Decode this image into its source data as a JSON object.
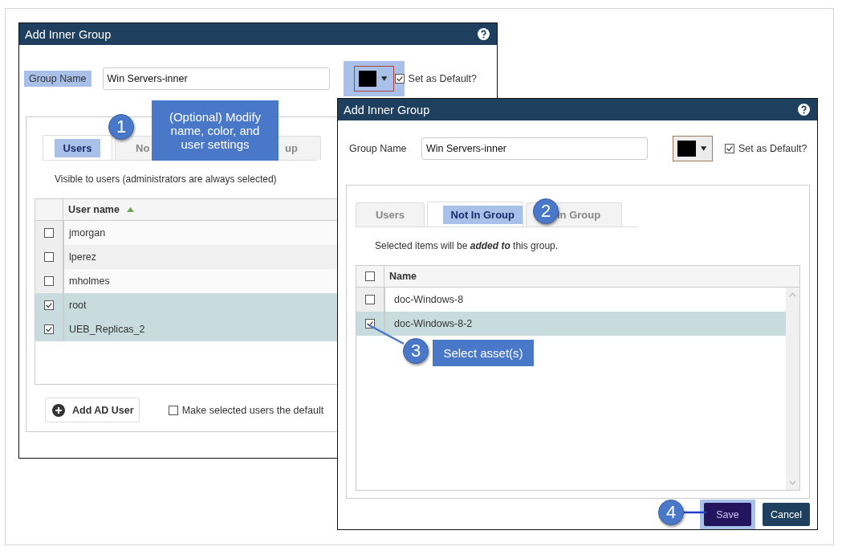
{
  "back_dialog": {
    "title": "Add Inner Group",
    "group_name_label": "Group Name",
    "group_name_value": "Win Servers-inner",
    "set_default": {
      "label": "Set as Default?",
      "checked": true
    },
    "tabs": [
      {
        "label": "Users",
        "selected": true
      },
      {
        "label": "No",
        "selected": false
      },
      {
        "label": "up",
        "selected": false
      }
    ],
    "hint": "Visible to users (administrators are always selected)",
    "table": {
      "columns": [
        "User name"
      ],
      "rows": [
        {
          "name": "jmorgan",
          "checked": false
        },
        {
          "name": "lperez",
          "checked": false
        },
        {
          "name": "mholmes",
          "checked": false
        },
        {
          "name": "root",
          "checked": true
        },
        {
          "name": "UEB_Replicas_2",
          "checked": true
        }
      ]
    },
    "add_button": "Add AD User",
    "default_option": {
      "label": "Make selected users the default",
      "checked": false
    }
  },
  "front_dialog": {
    "title": "Add Inner Group",
    "group_name_label": "Group Name",
    "group_name_value": "Win Servers-inner",
    "set_default": {
      "label": "Set as Default?",
      "checked": true
    },
    "tabs": [
      {
        "label": "Users",
        "selected": false
      },
      {
        "label": "Not In Group",
        "selected": true
      },
      {
        "label": "In Group",
        "selected": false
      }
    ],
    "hint": "Selected items will be **added to** this group.",
    "table": {
      "columns": [
        "Name"
      ],
      "header_checked": false,
      "rows": [
        {
          "name": "doc-Windows-8",
          "checked": false
        },
        {
          "name": "doc-Windows-8-2",
          "checked": true
        }
      ]
    },
    "buttons": [
      {
        "label": "Save",
        "kind": "primary"
      },
      {
        "label": "Cancel",
        "kind": "secondary"
      }
    ]
  },
  "callouts": [
    {
      "number": "1",
      "text": "(Optional) Modify name, color, and user settings"
    },
    {
      "number": "2"
    },
    {
      "number": "3",
      "text": "Select asset(s)"
    },
    {
      "number": "4"
    }
  ]
}
